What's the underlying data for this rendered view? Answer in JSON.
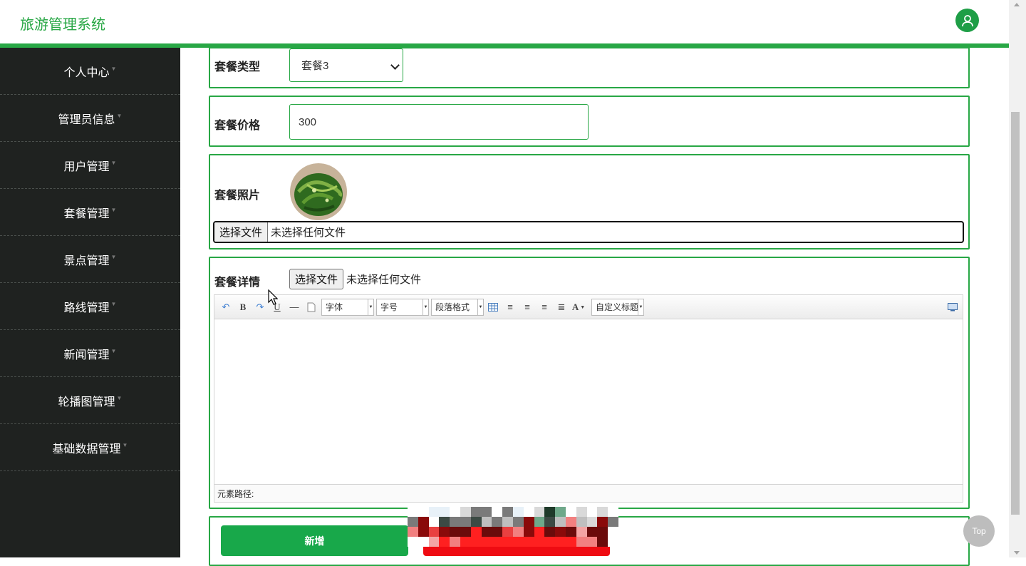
{
  "app": {
    "title": "旅游管理系统"
  },
  "sidebar": {
    "items": [
      {
        "label": "个人中心"
      },
      {
        "label": "管理员信息"
      },
      {
        "label": "用户管理"
      },
      {
        "label": "套餐管理"
      },
      {
        "label": "景点管理"
      },
      {
        "label": "路线管理"
      },
      {
        "label": "新闻管理"
      },
      {
        "label": "轮播图管理"
      },
      {
        "label": "基础数据管理"
      }
    ]
  },
  "form": {
    "package_type": {
      "label": "套餐类型",
      "value": "套餐3"
    },
    "package_price": {
      "label": "套餐价格",
      "value": "300"
    },
    "package_photo": {
      "label": "套餐照片",
      "file_button": "选择文件",
      "file_status": "未选择任何文件"
    },
    "package_detail": {
      "label": "套餐详情",
      "file_button": "选择文件",
      "file_status": "未选择任何文件"
    }
  },
  "editor": {
    "font_family": "字体",
    "font_size": "字号",
    "paragraph": "段落格式",
    "custom_heading": "自定义标题",
    "element_path": "元素路径:"
  },
  "actions": {
    "add_label": "新增"
  },
  "back_to_top": {
    "label": "Top"
  },
  "colors": {
    "accent": "#28a745",
    "sidebar": "#1f2220",
    "danger": "#ef0b12"
  }
}
